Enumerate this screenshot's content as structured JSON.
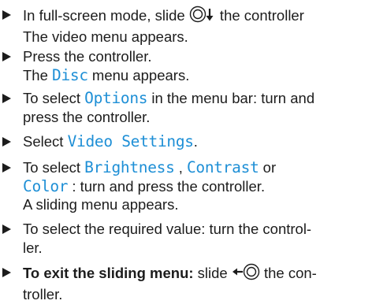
{
  "steps": [
    {
      "s1_a": "In full-screen mode, slide ",
      "s1_b": " the controller",
      "result": "The video menu appears."
    },
    {
      "text": "Press the controller.",
      "result_a": "The ",
      "result_ui": "Disc",
      "result_b": " menu appears."
    },
    {
      "a": "To select ",
      "ui": "Options",
      "b": " in the menu bar: turn and",
      "c": "press the controller."
    },
    {
      "a": "Select ",
      "ui": "Video Settings",
      "b": "."
    },
    {
      "a": "To select ",
      "ui1": "Brightness",
      "sep1": " , ",
      "ui2": "Contrast",
      "sep2": " or",
      "ui3": "Color",
      "b": " : turn and press the controller.",
      "result": "A sliding menu appears."
    },
    {
      "a": "To select the required value: turn the control-",
      "b": "ler."
    },
    {
      "bold": "To exit the sliding menu:",
      "a": " slide ",
      "b": " the con-",
      "c": "troller."
    }
  ],
  "icons": {
    "slide_down": "controller-slide-down-icon",
    "slide_left": "controller-slide-left-icon"
  }
}
